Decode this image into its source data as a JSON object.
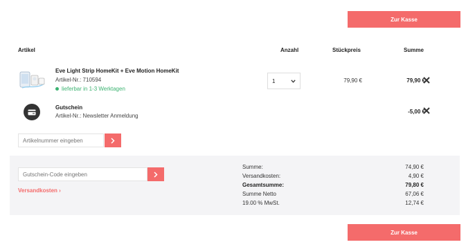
{
  "buttons": {
    "checkout_top": "Zur Kasse",
    "checkout_bottom": "Zur Kasse"
  },
  "columns": {
    "article": "Artikel",
    "quantity": "Anzahl",
    "unit_price": "Stückpreis",
    "total": "Summe"
  },
  "items": [
    {
      "title": "Eve Light Strip HomeKit + Eve Motion HomeKit",
      "article_no": "Artikel-Nr.: 710594",
      "availability": "lieferbar in 1-3 Werktagen",
      "quantity": "1",
      "unit_price": "79,90 €",
      "total": "79,90 €"
    },
    {
      "title": "Gutschein",
      "article_no": "Artikel-Nr.: Newsletter Anmeldung",
      "total": "-5,00 €"
    }
  ],
  "article_input": {
    "placeholder": "Artikelnummer eingeben"
  },
  "voucher_input": {
    "placeholder": "Gutschein-Code eingeben"
  },
  "shipping_link": "Versandkosten",
  "summary": {
    "subtotal_label": "Summe:",
    "subtotal_value": "74,90 €",
    "shipping_label": "Versandkosten:",
    "shipping_value": "4,90 €",
    "grand_total_label": "Gesamtsumme:",
    "grand_total_value": "79,80 €",
    "net_label": "Summe Netto",
    "net_value": "67,06 €",
    "vat_label": "19.00 % MwSt.",
    "vat_value": "12,74 €"
  },
  "colors": {
    "accent": "#f46b6b",
    "in_stock": "#3cb371",
    "panel": "#f4f4f6"
  },
  "icons": [
    "close-icon",
    "chevron-down-icon",
    "chevron-right-icon",
    "voucher-card-icon"
  ]
}
